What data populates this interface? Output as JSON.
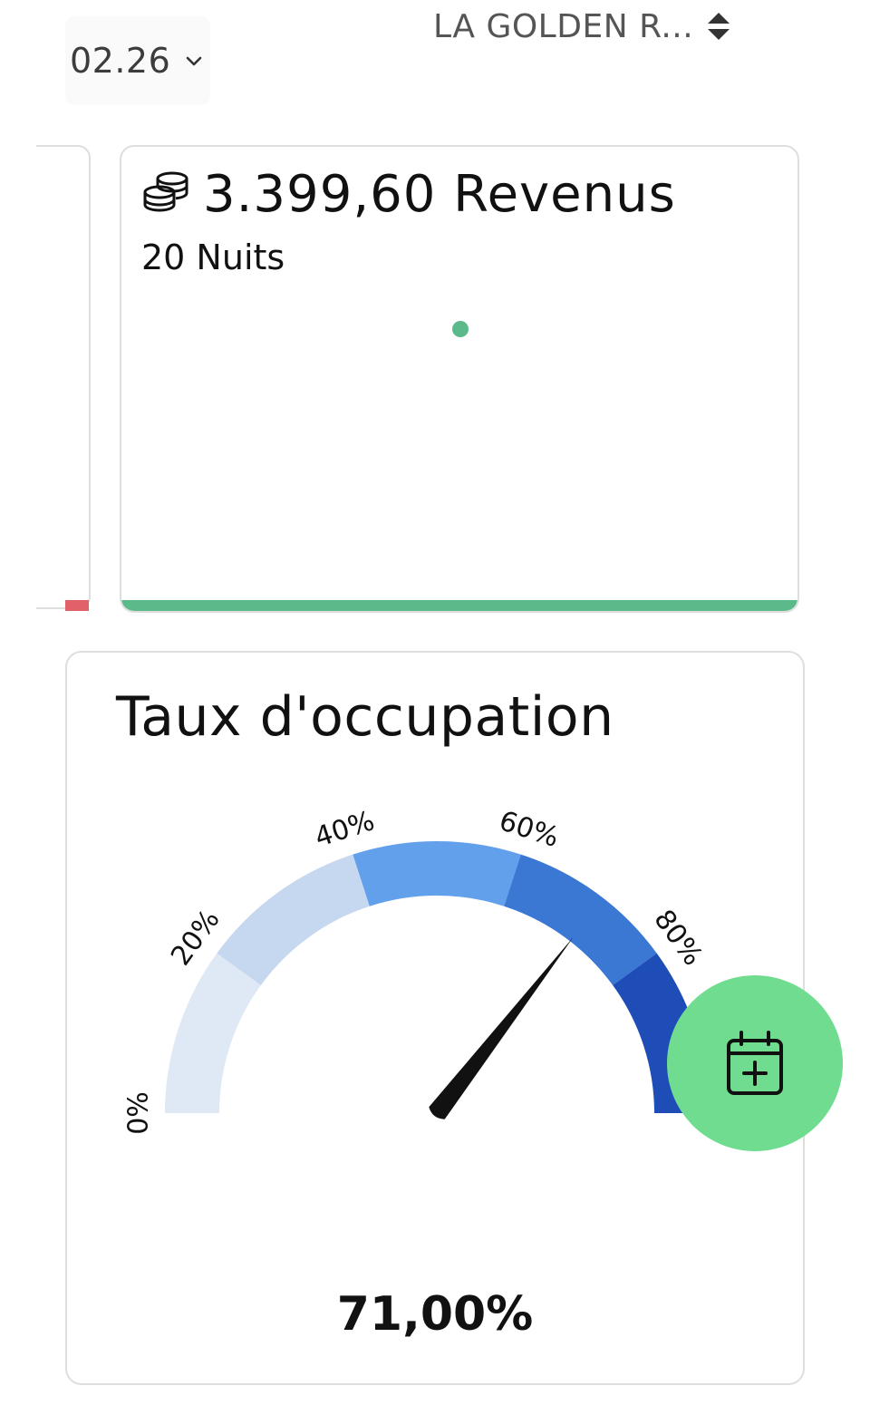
{
  "header": {
    "month": "02.26",
    "property": "LA GOLDEN R..."
  },
  "revenue_card": {
    "amount": "3.399,60 Revenus",
    "nights": "20 Nuits",
    "icon": "coins-icon",
    "accent_color": "#5bb98a"
  },
  "occupancy_card": {
    "title": "Taux d'occupation",
    "value_label": "71,00%",
    "icon": "gauge-needle"
  },
  "chart_data": {
    "type": "gauge",
    "value": 71,
    "range": [
      0,
      100
    ],
    "ticks": [
      "0%",
      "20%",
      "40%",
      "60%",
      "80%"
    ],
    "bands": [
      {
        "from": 0,
        "to": 20,
        "color": "#dfe8f5"
      },
      {
        "from": 20,
        "to": 40,
        "color": "#c5d8f0"
      },
      {
        "from": 40,
        "to": 60,
        "color": "#63a0ec"
      },
      {
        "from": 60,
        "to": 80,
        "color": "#3a78d4"
      },
      {
        "from": 80,
        "to": 100,
        "color": "#1f4db8"
      }
    ]
  },
  "fab": {
    "icon": "calendar-plus-icon",
    "color": "#6fdc8f"
  }
}
